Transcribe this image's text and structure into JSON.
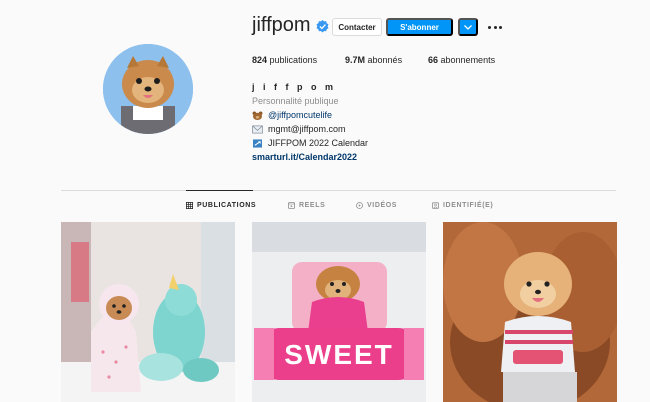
{
  "profile": {
    "username": "jiffpom",
    "full_name": "j i f f p o m",
    "category": "Personnalité publique",
    "bio": [
      {
        "icon": "bear-icon",
        "text": "@jiffpomcutelife"
      },
      {
        "icon": "email-icon",
        "text": "mgmt@jiffpom.com"
      },
      {
        "icon": "calendar-icon",
        "text": "JIFFPOM 2022 Calendar"
      }
    ],
    "website": "smarturl.it/Calendar2022"
  },
  "actions": {
    "contact_label": "Contacter",
    "follow_label": "S'abonner"
  },
  "stats": {
    "posts_count": "824",
    "posts_label": "publications",
    "followers_count": "9.7M",
    "followers_label": "abonnés",
    "following_count": "66",
    "following_label": "abonnements"
  },
  "tabs": [
    {
      "label": "PUBLICATIONS",
      "icon": "grid-icon",
      "active": true
    },
    {
      "label": "REELS",
      "icon": "reels-icon",
      "active": false
    },
    {
      "label": "VIDÉOS",
      "icon": "video-icon",
      "active": false
    },
    {
      "label": "IDENTIFIÉ(E)",
      "icon": "tag-icon",
      "active": false
    }
  ],
  "posts": [
    {
      "text_on_image": ""
    },
    {
      "text_on_image": "SWEET"
    },
    {
      "text_on_image": ""
    }
  ],
  "colors": {
    "accent": "#0095f6",
    "link": "#00376b",
    "muted": "#8e8e8e"
  }
}
